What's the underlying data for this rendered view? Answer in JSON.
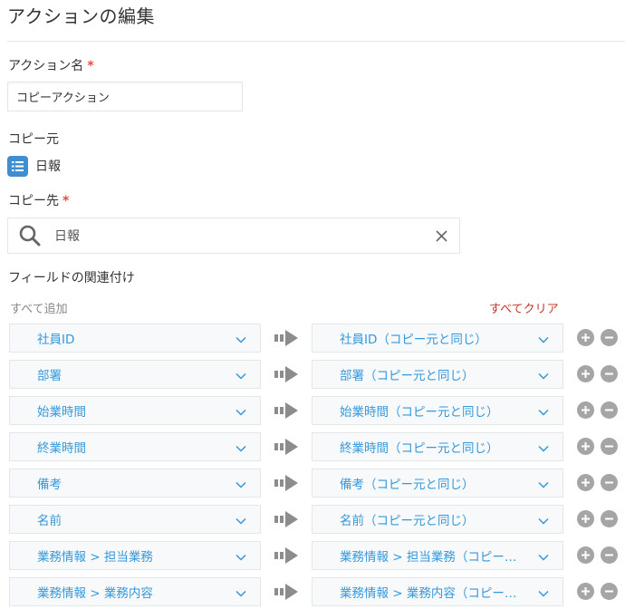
{
  "page": {
    "title": "アクションの編集"
  },
  "action_name": {
    "label": "アクション名",
    "required_mark": "*",
    "value": "コピーアクション"
  },
  "copy_source": {
    "label": "コピー元",
    "app_name": "日報",
    "icon": "list-app-icon"
  },
  "copy_dest": {
    "label": "コピー先",
    "required_mark": "*",
    "search_value": "日報",
    "search_icon": "search-icon",
    "clear_icon": "close-icon"
  },
  "field_mapping": {
    "label": "フィールドの関連付け",
    "add_all": "すべて追加",
    "clear_all": "すべてクリア",
    "rows": [
      {
        "source": "社員ID",
        "dest": "社員ID（コピー元と同じ）"
      },
      {
        "source": "部署",
        "dest": "部署（コピー元と同じ）"
      },
      {
        "source": "始業時間",
        "dest": "始業時間（コピー元と同じ）"
      },
      {
        "source": "終業時間",
        "dest": "終業時間（コピー元と同じ）"
      },
      {
        "source": "備考",
        "dest": "備考（コピー元と同じ）"
      },
      {
        "source": "名前",
        "dest": "名前（コピー元と同じ）"
      },
      {
        "source": "業務情報 > 担当業務",
        "dest": "業務情報 > 担当業務（コピー…"
      },
      {
        "source": "業務情報 > 業務内容",
        "dest": "業務情報 > 業務内容（コピー…"
      }
    ]
  },
  "colors": {
    "link_blue": "#3498db",
    "clear_red": "#c0392b",
    "required_red": "#e74c3c",
    "app_icon_blue": "#3f8fd0",
    "button_gray": "#a5a5a5"
  }
}
